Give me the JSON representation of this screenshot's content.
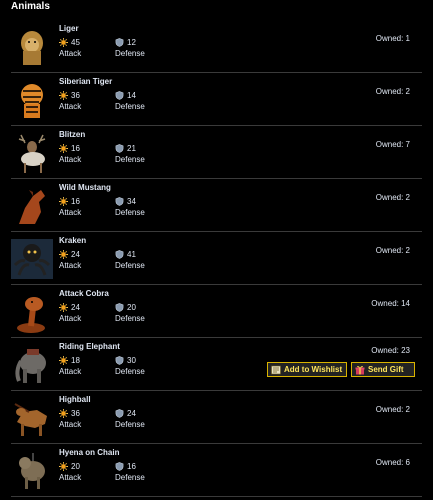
{
  "header": {
    "title": "Animals"
  },
  "labels": {
    "attack": "Attack",
    "defense": "Defense"
  },
  "icons": {
    "attack": "sun-icon",
    "defense": "shield-icon"
  },
  "items": [
    {
      "name": "Liger",
      "attack": "45",
      "defense": "12",
      "owned": "Owned: 1",
      "thumb": "liger"
    },
    {
      "name": "Siberian Tiger",
      "attack": "36",
      "defense": "14",
      "owned": "Owned: 2",
      "thumb": "tiger"
    },
    {
      "name": "Blitzen",
      "attack": "16",
      "defense": "21",
      "owned": "Owned: 7",
      "thumb": "reindeer"
    },
    {
      "name": "Wild Mustang",
      "attack": "16",
      "defense": "34",
      "owned": "Owned: 2",
      "thumb": "horse"
    },
    {
      "name": "Kraken",
      "attack": "24",
      "defense": "41",
      "owned": "Owned: 2",
      "thumb": "kraken"
    },
    {
      "name": "Attack Cobra",
      "attack": "24",
      "defense": "20",
      "owned": "Owned: 14",
      "thumb": "cobra"
    },
    {
      "name": "Riding Elephant",
      "attack": "18",
      "defense": "30",
      "owned": "Owned: 23",
      "thumb": "elephant",
      "actions": {
        "wishlist": "Add to Wishlist",
        "gift": "Send Gift"
      }
    },
    {
      "name": "Highball",
      "attack": "36",
      "defense": "24",
      "owned": "Owned: 2",
      "thumb": "dog"
    },
    {
      "name": "Hyena on Chain",
      "attack": "20",
      "defense": "16",
      "owned": "Owned: 6",
      "thumb": "hyena"
    }
  ],
  "colors": {
    "button_border": "#d9b300",
    "button_text": "#ffe55c",
    "divider": "#3a3a3a",
    "text": "#dfe6f2"
  }
}
